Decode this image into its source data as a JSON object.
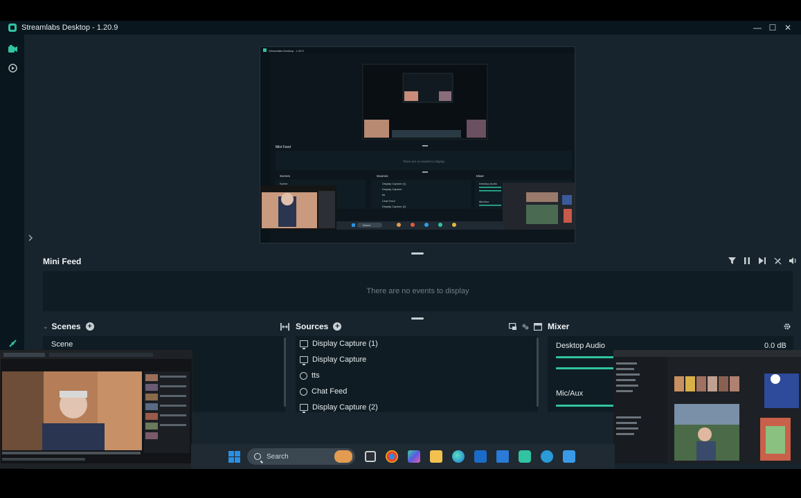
{
  "window": {
    "title": "Streamlabs Desktop - 1.20.9",
    "minimize": "—",
    "maximize": "☐",
    "close": "✕"
  },
  "rail": {
    "icons": [
      "editor-icon",
      "play-icon",
      "integration-icon"
    ]
  },
  "preview": {
    "inner_title": "Streamlabs Desktop - 1.20.9",
    "inner_minifeed": "Mini Feed",
    "inner_empty": "There are no events to display",
    "inner_scenes": "Scenes",
    "inner_sources": "Sources",
    "inner_mixer": "Mixer",
    "inner_sources_list": [
      "Display Capture (1)",
      "Display Capture",
      "tts",
      "Chat Feed",
      "Display Capture (2)"
    ],
    "inner_mixer_labels": [
      "Desktop Audio",
      "Mic/Aux"
    ],
    "inner_scene": "Scene",
    "inner_search": "Search"
  },
  "minifeed": {
    "title": "Mini Feed",
    "empty_text": "There are no events to display",
    "tools": [
      "filter-icon",
      "pause-icon",
      "skip-icon",
      "mute-alerts-icon",
      "volume-icon"
    ]
  },
  "scenes": {
    "title": "Scenes",
    "items": [
      "Scene"
    ]
  },
  "sources": {
    "title": "Sources",
    "items": [
      {
        "label": "Display Capture (1)",
        "icon": "monitor-icon"
      },
      {
        "label": "Display Capture",
        "icon": "monitor-icon"
      },
      {
        "label": "tts",
        "icon": "globe-icon"
      },
      {
        "label": "Chat Feed",
        "icon": "globe-icon"
      },
      {
        "label": "Display Capture (2)",
        "icon": "monitor-icon"
      }
    ]
  },
  "mixer": {
    "title": "Mixer",
    "channels": [
      {
        "name": "Desktop Audio",
        "level": "0.0 dB"
      },
      {
        "name": "Mic/Aux",
        "level": ""
      }
    ]
  },
  "taskbar": {
    "search_placeholder": "Search",
    "apps": [
      "file-explorer-icon",
      "chrome-icon",
      "copilot-icon",
      "folder-icon",
      "edge-icon",
      "outlook-icon",
      "store-icon",
      "streamlabs-icon",
      "telegram-icon",
      "photos-icon"
    ]
  },
  "colors": {
    "accent": "#31c3a2",
    "background": "#17242d",
    "panel": "#0f1c23",
    "titlebar": "#09161d"
  }
}
